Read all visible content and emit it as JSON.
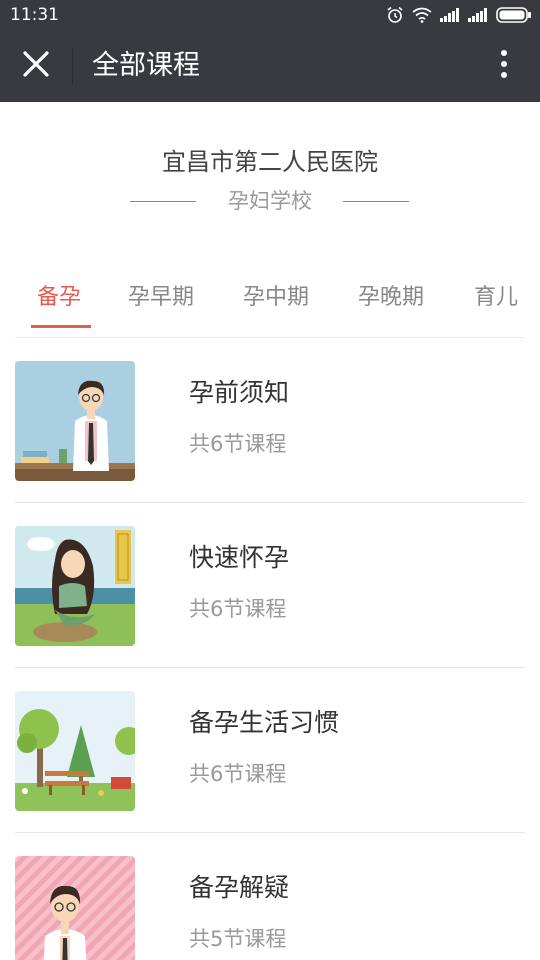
{
  "status_bar": {
    "time": "11:31",
    "icons": [
      "alarm-icon",
      "wifi-icon",
      "signal-icon",
      "signal-icon",
      "battery-icon"
    ]
  },
  "top_bar": {
    "close_icon": "close-icon",
    "title": "全部课程",
    "more_icon": "more-vertical-icon"
  },
  "header": {
    "hospital": "宜昌市第二人民医院",
    "subtitle": "孕妇学校"
  },
  "tabs": {
    "active_color": "#e85a4f",
    "items": [
      {
        "label": "备孕",
        "active": true
      },
      {
        "label": "孕早期",
        "active": false
      },
      {
        "label": "孕中期",
        "active": false
      },
      {
        "label": "孕晚期",
        "active": false
      },
      {
        "label": "育儿",
        "active": false
      }
    ]
  },
  "courses": [
    {
      "title": "孕前须知",
      "lessons": "共6节课程",
      "image": "doctor-at-desk-illustration"
    },
    {
      "title": "快速怀孕",
      "lessons": "共6节课程",
      "image": "mermaid-seaside-illustration"
    },
    {
      "title": "备孕生活习惯",
      "lessons": "共6节课程",
      "image": "park-bench-illustration"
    },
    {
      "title": "备孕解疑",
      "lessons": "共5节课程",
      "image": "doctor-pink-background-illustration"
    }
  ]
}
